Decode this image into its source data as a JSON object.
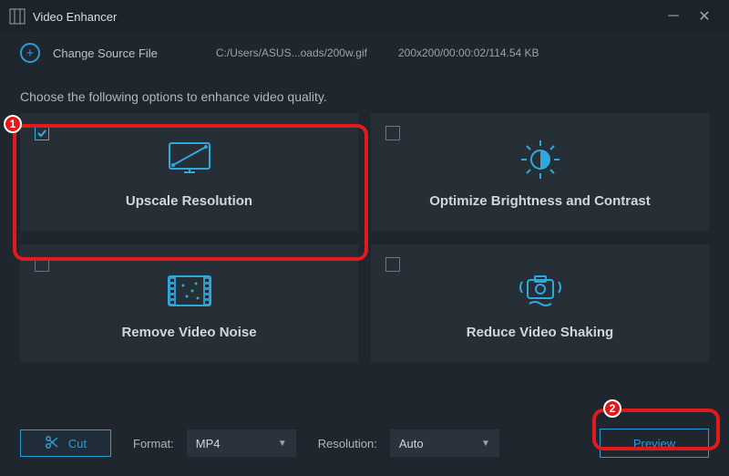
{
  "window": {
    "title": "Video Enhancer"
  },
  "topbar": {
    "change_label": "Change Source File",
    "file_path": "C:/Users/ASUS...oads/200w.gif",
    "file_info": "200x200/00:00:02/114.54 KB"
  },
  "instruction": "Choose the following options to enhance video quality.",
  "cards": [
    {
      "label": "Upscale Resolution",
      "checked": true,
      "icon": "monitor-diag-icon"
    },
    {
      "label": "Optimize Brightness and Contrast",
      "checked": false,
      "icon": "brightness-icon"
    },
    {
      "label": "Remove Video Noise",
      "checked": false,
      "icon": "film-noise-icon"
    },
    {
      "label": "Reduce Video Shaking",
      "checked": false,
      "icon": "camera-shake-icon"
    }
  ],
  "bottom": {
    "cut_label": "Cut",
    "format_label": "Format:",
    "format_value": "MP4",
    "resolution_label": "Resolution:",
    "resolution_value": "Auto",
    "preview_label": "Preview"
  },
  "annotations": {
    "n1": "1",
    "n2": "2"
  }
}
